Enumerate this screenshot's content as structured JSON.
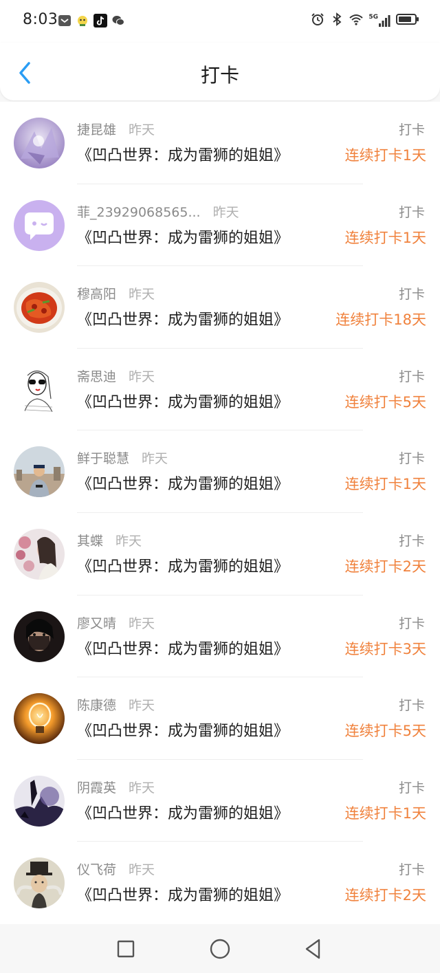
{
  "status_bar": {
    "time": "8:03",
    "network": "5G",
    "left_icons": [
      "message-icon",
      "app-icon",
      "tiktok-icon",
      "wechat-icon"
    ],
    "right_icons": [
      "alarm-icon",
      "bluetooth-icon",
      "wifi-icon",
      "signal-icon",
      "battery-icon"
    ]
  },
  "header": {
    "title": "打卡",
    "back_icon": "chevron-left-icon"
  },
  "colors": {
    "accent_back": "#2a9df4",
    "streak": "#f0823d",
    "muted": "#8a8a8a"
  },
  "entries": [
    {
      "name": "捷昆雄",
      "time": "昨天",
      "book": "《凹凸世界：成为雷狮的姐姐》",
      "action": "打卡",
      "streak": "连续打卡1天",
      "avatar": "avatar-purple-crystal"
    },
    {
      "name": "菲_23929068565...",
      "time": "昨天",
      "book": "《凹凸世界：成为雷狮的姐姐》",
      "action": "打卡",
      "streak": "连续打卡1天",
      "avatar": "avatar-default-chat"
    },
    {
      "name": "穆高阳",
      "time": "昨天",
      "book": "《凹凸世界：成为雷狮的姐姐》",
      "action": "打卡",
      "streak": "连续打卡18天",
      "avatar": "avatar-food-plate"
    },
    {
      "name": "斋思迪",
      "time": "昨天",
      "book": "《凹凸世界：成为雷狮的姐姐》",
      "action": "打卡",
      "streak": "连续打卡5天",
      "avatar": "avatar-sketch-girl"
    },
    {
      "name": "鲜于聪慧",
      "time": "昨天",
      "book": "《凹凸世界：成为雷狮的姐姐》",
      "action": "打卡",
      "streak": "连续打卡1天",
      "avatar": "avatar-city-man"
    },
    {
      "name": "其蝶",
      "time": "昨天",
      "book": "《凹凸世界：成为雷狮的姐姐》",
      "action": "打卡",
      "streak": "连续打卡2天",
      "avatar": "avatar-woman-flowers"
    },
    {
      "name": "廖又晴",
      "time": "昨天",
      "book": "《凹凸世界：成为雷狮的姐姐》",
      "action": "打卡",
      "streak": "连续打卡3天",
      "avatar": "avatar-dark-portrait"
    },
    {
      "name": "陈康德",
      "time": "昨天",
      "book": "《凹凸世界：成为雷狮的姐姐》",
      "action": "打卡",
      "streak": "连续打卡5天",
      "avatar": "avatar-lightbulb"
    },
    {
      "name": "阴霞英",
      "time": "昨天",
      "book": "《凹凸世界：成为雷狮的姐姐》",
      "action": "打卡",
      "streak": "连续打卡1天",
      "avatar": "avatar-dark-castle"
    },
    {
      "name": "仪飞荷",
      "time": "昨天",
      "book": "《凹凸世界：成为雷狮的姐姐》",
      "action": "打卡",
      "streak": "连续打卡2天",
      "avatar": "avatar-top-hat"
    }
  ],
  "nav_bar": {
    "buttons": [
      "recent-apps-icon",
      "home-icon",
      "back-triangle-icon"
    ]
  }
}
